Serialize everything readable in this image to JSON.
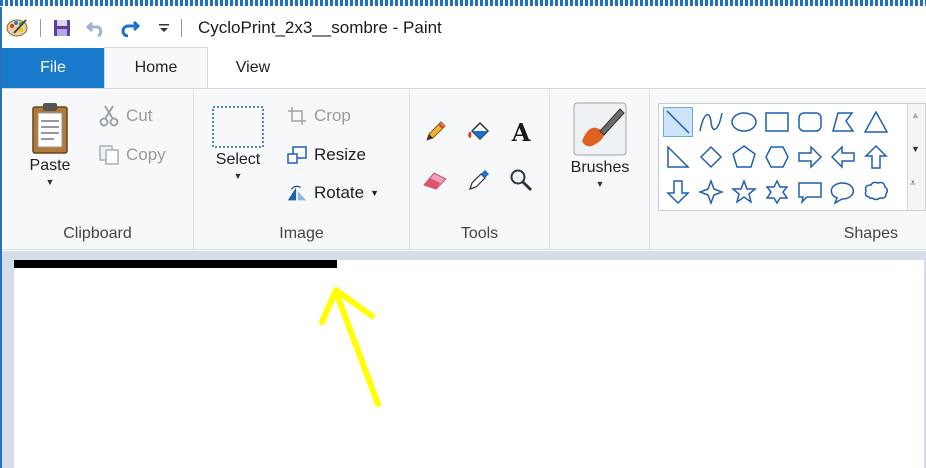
{
  "window": {
    "title": "CycloPrint_2x3__sombre - Paint",
    "qa_more_glyph": "▾"
  },
  "tabs": [
    {
      "label": "File"
    },
    {
      "label": "Home"
    },
    {
      "label": "View"
    }
  ],
  "clipboard": {
    "group_label": "Clipboard",
    "paste_label": "Paste",
    "cut_label": "Cut",
    "copy_label": "Copy"
  },
  "image": {
    "group_label": "Image",
    "select_label": "Select",
    "crop_label": "Crop",
    "resize_label": "Resize",
    "rotate_label": "Rotate"
  },
  "tools": {
    "group_label": "Tools",
    "text_glyph": "A"
  },
  "brushes": {
    "label": "Brushes"
  },
  "shapes": {
    "group_label": "Shapes"
  },
  "colors": {
    "accent": "#1979ca",
    "annotation_arrow": "#ffff00",
    "stroke": "#000000"
  }
}
